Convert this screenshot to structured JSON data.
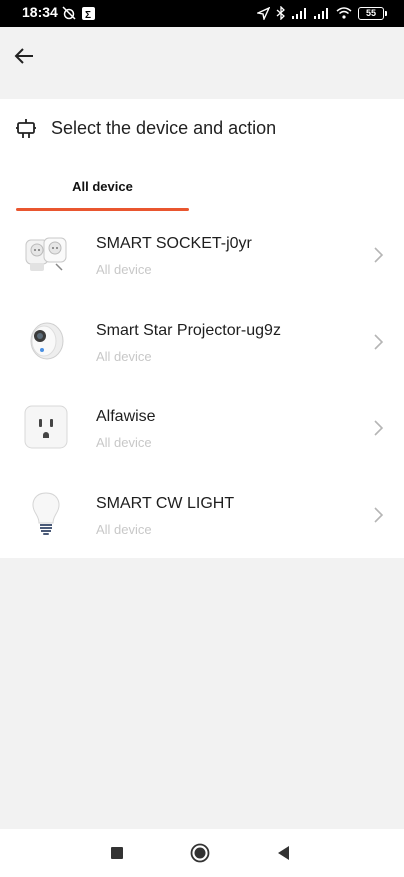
{
  "status_bar": {
    "time": "18:34",
    "battery": "55",
    "icons": [
      "alarm-off-icon",
      "notification-icon",
      "location-icon",
      "bluetooth-icon",
      "signal-icon",
      "signal-icon",
      "wifi-icon",
      "battery-icon"
    ]
  },
  "header": {
    "back_icon": "arrow-left-icon",
    "title_icon": "device-icon",
    "title": "Select the device and action"
  },
  "tabs": [
    {
      "label": "All device",
      "active": true
    }
  ],
  "accent_color": "#e9562f",
  "devices": [
    {
      "name": "SMART SOCKET-j0yr",
      "category": "All device",
      "icon": "dual-socket-icon"
    },
    {
      "name": "Smart Star Projector-ug9z",
      "category": "All device",
      "icon": "projector-icon"
    },
    {
      "name": "Alfawise",
      "category": "All device",
      "icon": "wall-outlet-icon"
    },
    {
      "name": "SMART CW LIGHT",
      "category": "All device",
      "icon": "light-bulb-icon"
    }
  ],
  "nav": [
    "recents-button",
    "home-button",
    "back-button"
  ]
}
